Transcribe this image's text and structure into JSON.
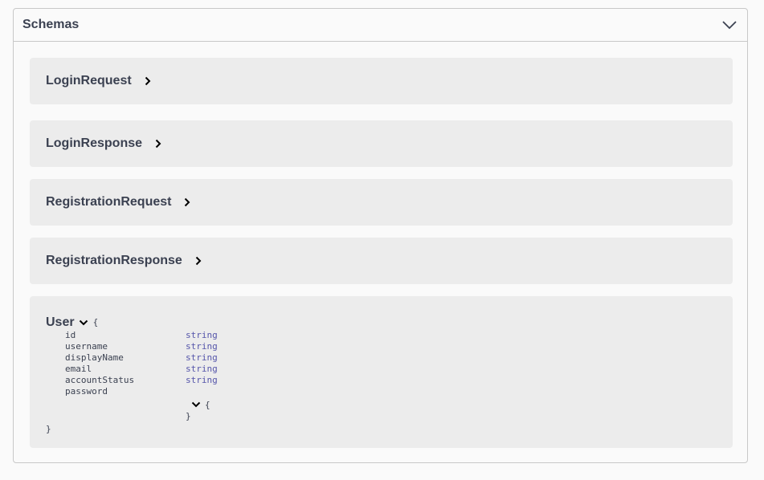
{
  "section": {
    "title": "Schemas"
  },
  "models": [
    {
      "name": "LoginRequest"
    },
    {
      "name": "LoginResponse"
    },
    {
      "name": "RegistrationRequest"
    },
    {
      "name": "RegistrationResponse"
    }
  ],
  "expanded_model": {
    "name": "User",
    "open_brace": "{",
    "close_brace": "}",
    "properties": [
      {
        "name": "id",
        "type": "string"
      },
      {
        "name": "username",
        "type": "string"
      },
      {
        "name": "displayName",
        "type": "string"
      },
      {
        "name": "email",
        "type": "string"
      },
      {
        "name": "accountStatus",
        "type": "string"
      },
      {
        "name": "password",
        "type": ""
      }
    ],
    "nested_open": "{",
    "nested_close": "}"
  },
  "icons": {
    "header": "chevron-down-icon",
    "row": "chevron-right-icon",
    "expanded": "chevron-down-icon"
  },
  "colors": {
    "type_text": "#5555aa",
    "box_bg": "#ececec",
    "border": "#c8c8c8"
  }
}
